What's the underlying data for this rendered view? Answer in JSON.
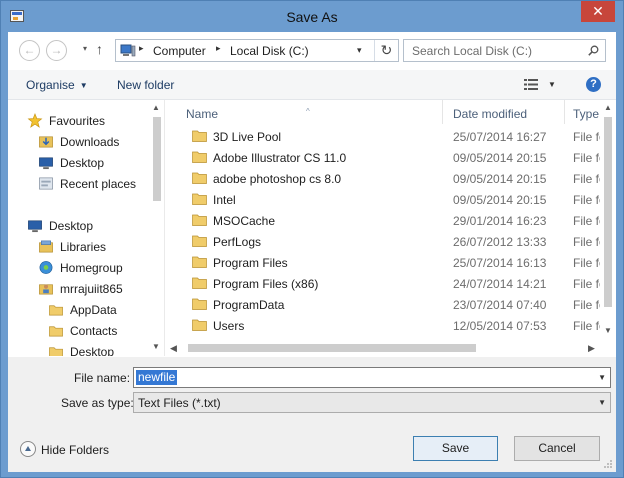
{
  "window": {
    "title": "Save As",
    "close_glyph": "✕"
  },
  "nav_buttons": {
    "back_glyph": "←",
    "forward_glyph": "→",
    "recent_glyph": "▾",
    "up_glyph": "↑"
  },
  "address": {
    "crumbs": [
      "Computer",
      "Local Disk (C:)"
    ],
    "separator": "▸",
    "dropdown_glyph": "▾",
    "refresh_glyph": "↻"
  },
  "search": {
    "placeholder": "Search Local Disk (C:)"
  },
  "toolbar": {
    "organise_label": "Organise",
    "organise_caret": "▼",
    "new_folder_label": "New folder",
    "view_caret": "▼",
    "help_glyph": "?"
  },
  "navigation": {
    "items": [
      {
        "label": "Favourites",
        "icon": "star-icon"
      },
      {
        "label": "Downloads",
        "icon": "downloads-icon"
      },
      {
        "label": "Desktop",
        "icon": "desktop-icon"
      },
      {
        "label": "Recent places",
        "icon": "recent-places-icon"
      },
      {
        "label": "Desktop",
        "icon": "desktop-icon"
      },
      {
        "label": "Libraries",
        "icon": "libraries-icon"
      },
      {
        "label": "Homegroup",
        "icon": "homegroup-icon"
      },
      {
        "label": "mrrajuiit865",
        "icon": "user-folder-icon"
      },
      {
        "label": "AppData",
        "icon": "folder-icon"
      },
      {
        "label": "Contacts",
        "icon": "folder-icon"
      },
      {
        "label": "Desktop",
        "icon": "folder-icon"
      }
    ],
    "scroll_up": "▲",
    "scroll_down": "▼"
  },
  "columns": {
    "name": "Name",
    "date": "Date modified",
    "type": "Type",
    "sort_glyph": "^"
  },
  "files": [
    {
      "name": "3D Live Pool",
      "date": "25/07/2014 16:27",
      "type": "File fol"
    },
    {
      "name": "Adobe Illustrator CS 11.0",
      "date": "09/05/2014 20:15",
      "type": "File fol"
    },
    {
      "name": "adobe photoshop cs 8.0",
      "date": "09/05/2014 20:15",
      "type": "File fol"
    },
    {
      "name": "Intel",
      "date": "09/05/2014 20:15",
      "type": "File fol"
    },
    {
      "name": "MSOCache",
      "date": "29/01/2014 16:23",
      "type": "File fol"
    },
    {
      "name": "PerfLogs",
      "date": "26/07/2012 13:33",
      "type": "File fol"
    },
    {
      "name": "Program Files",
      "date": "25/07/2014 16:13",
      "type": "File fol"
    },
    {
      "name": "Program Files (x86)",
      "date": "24/07/2014 14:21",
      "type": "File fol"
    },
    {
      "name": "ProgramData",
      "date": "23/07/2014 07:40",
      "type": "File fol"
    },
    {
      "name": "Users",
      "date": "12/05/2014 07:53",
      "type": "File fol"
    }
  ],
  "file_scroll": {
    "up": "▲",
    "down": "▼",
    "left": "◀",
    "right": "▶"
  },
  "form": {
    "filename_label": "File name:",
    "filename_value": "newfile",
    "savetype_label": "Save as type:",
    "savetype_value": "Text Files (*.txt)",
    "caret": "▼"
  },
  "footer": {
    "hide_folders_label": "Hide Folders",
    "save_label": "Save",
    "cancel_label": "Cancel"
  }
}
